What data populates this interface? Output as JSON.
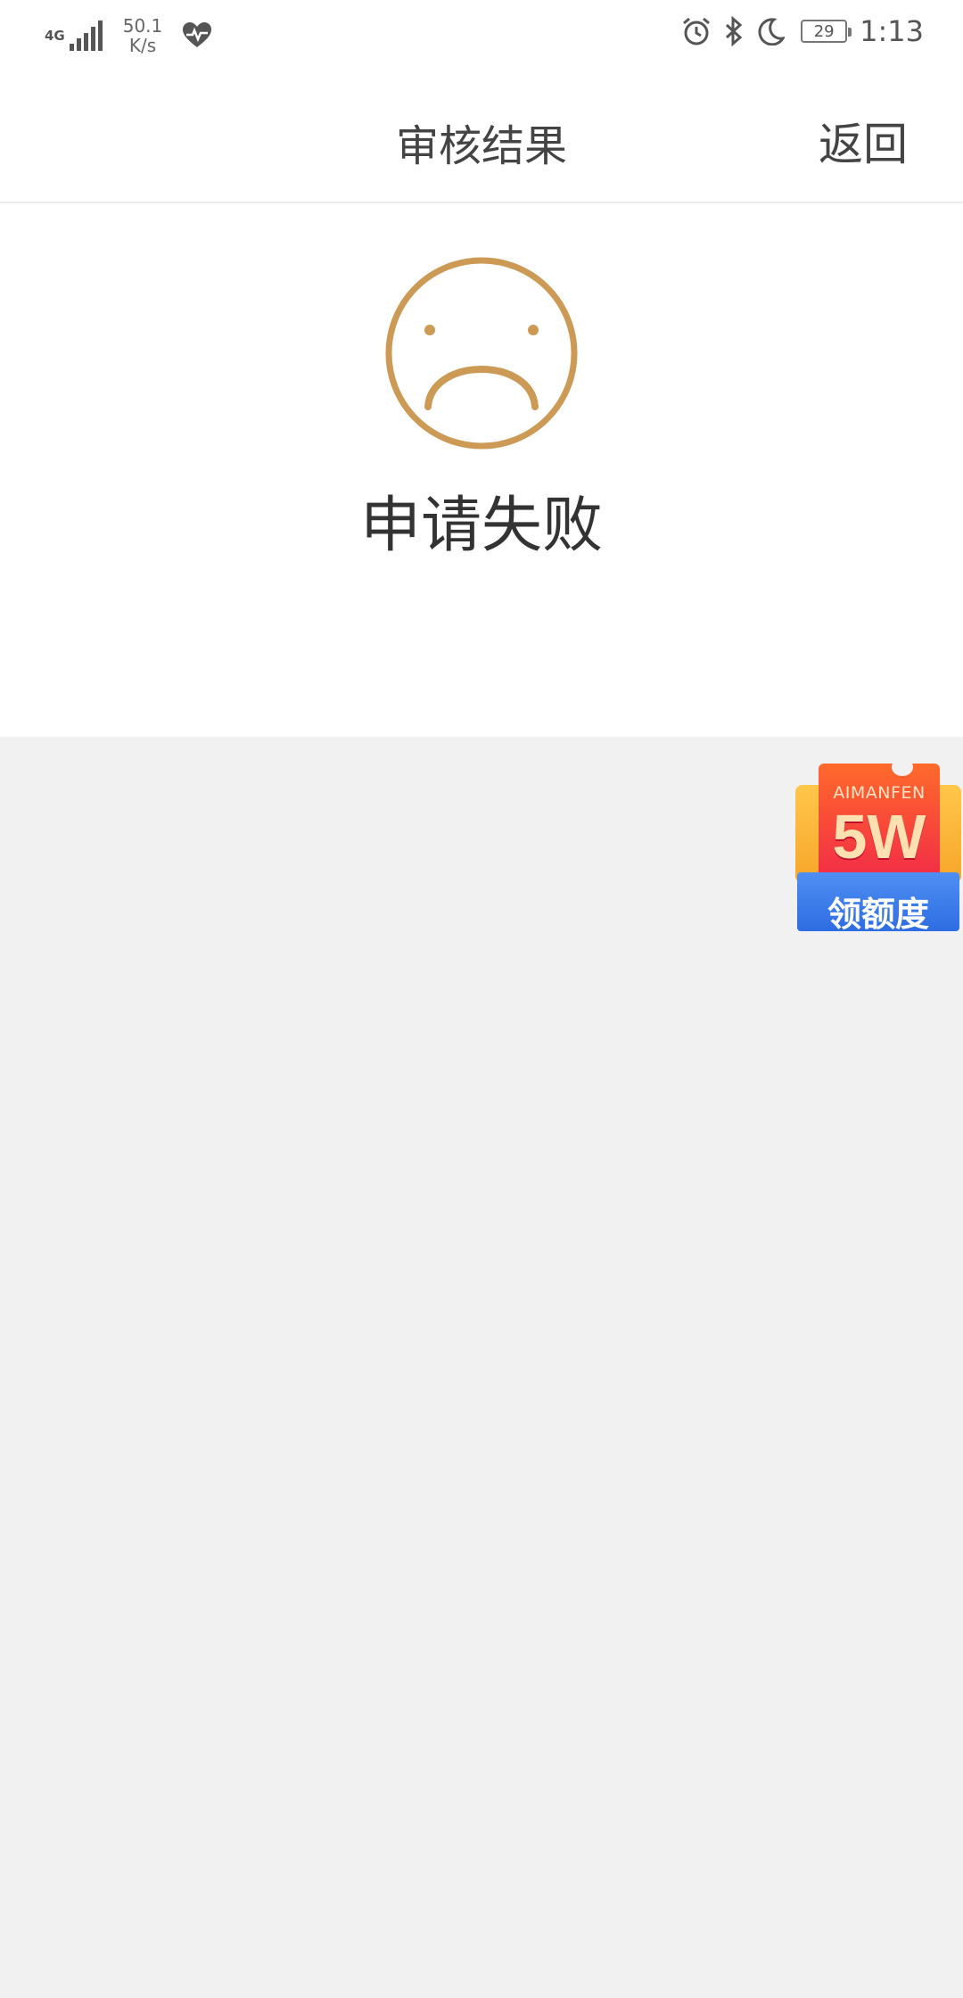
{
  "status_bar": {
    "network": "4G",
    "speed_value": "50.1",
    "speed_unit": "K/s",
    "battery": "29",
    "time": "1:13",
    "icons": [
      "signal-icon",
      "health-heart-icon",
      "alarm-icon",
      "bluetooth-icon",
      "moon-icon",
      "battery-icon"
    ]
  },
  "header": {
    "title": "审核结果",
    "back_label": "返回"
  },
  "result": {
    "icon": "sad-face-icon",
    "message": "申请失败",
    "accent_color": "#CC9A55"
  },
  "promo": {
    "brand": "AIMANFEN",
    "amount": "5W",
    "label": "领额度"
  },
  "colors": {
    "background": "#F1F1F1",
    "panel": "#FFFFFF",
    "text": "#444444"
  }
}
